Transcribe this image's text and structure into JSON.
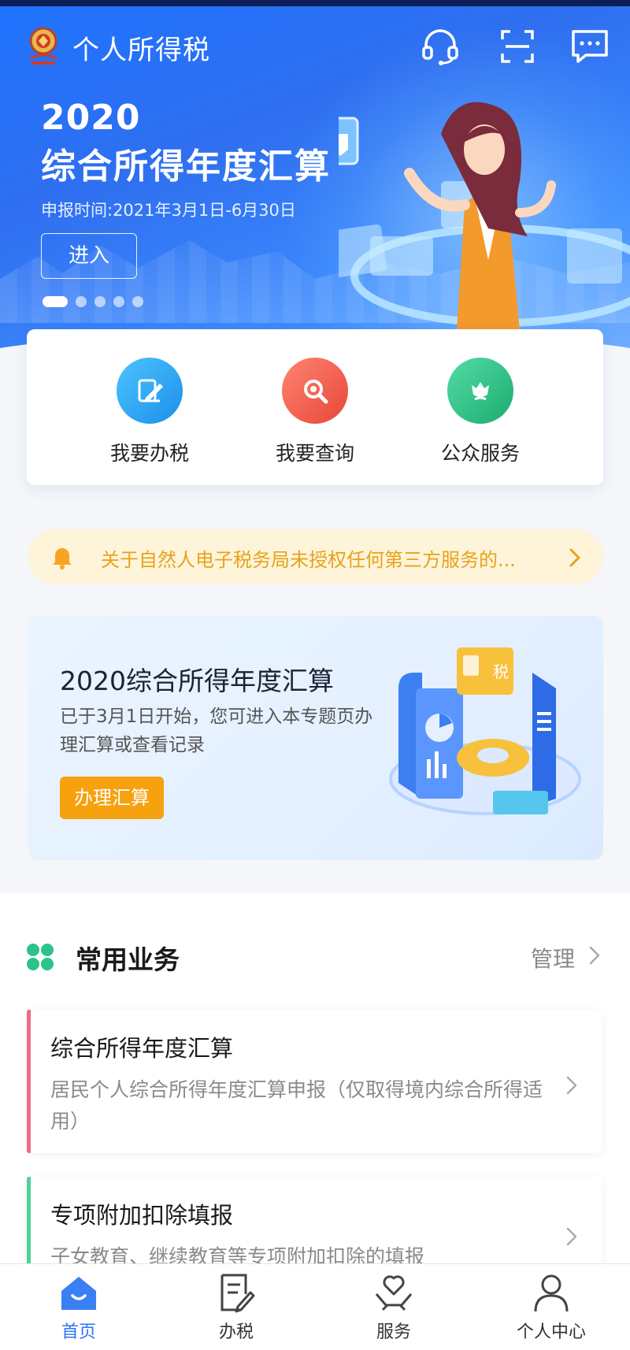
{
  "app": {
    "title": "个人所得税"
  },
  "banner": {
    "year": "2020",
    "title": "综合所得年度汇算",
    "period": "申报时间:2021年3月1日-6月30日",
    "enter_label": "进入",
    "slides_total": 5,
    "active_slide": 1
  },
  "quick_actions": [
    {
      "label": "我要办税",
      "icon": "pencil-document-icon",
      "color": "#2aa6f0"
    },
    {
      "label": "我要查询",
      "icon": "magnifier-icon",
      "color": "#f2574c"
    },
    {
      "label": "公众服务",
      "icon": "tulip-flower-icon",
      "color": "#2cc38a"
    }
  ],
  "notice": {
    "text": "关于自然人电子税务局未授权任何第三方服务的..."
  },
  "promo": {
    "title": "2020综合所得年度汇算",
    "description": "已于3月1日开始，您可进入本专题页办理汇算或查看记录",
    "button_label": "办理汇算"
  },
  "common_business": {
    "title": "常用业务",
    "manage_label": "管理",
    "items": [
      {
        "title": "综合所得年度汇算",
        "description": "居民个人综合所得年度汇算申报（仅取得境内综合所得适用）",
        "accent": "#f0698a"
      },
      {
        "title": "专项附加扣除填报",
        "description": "子女教育、继续教育等专项附加扣除的填报",
        "accent": "#4fd19a"
      }
    ]
  },
  "bottom_nav": [
    {
      "label": "首页",
      "icon": "home-icon",
      "active": true
    },
    {
      "label": "办税",
      "icon": "tax-form-icon",
      "active": false
    },
    {
      "label": "服务",
      "icon": "heart-hands-icon",
      "active": false
    },
    {
      "label": "个人中心",
      "icon": "person-icon",
      "active": false
    }
  ],
  "colors": {
    "primary": "#2d74f6",
    "warning_text": "#e8a21b",
    "promo_button": "#f6a10e"
  }
}
